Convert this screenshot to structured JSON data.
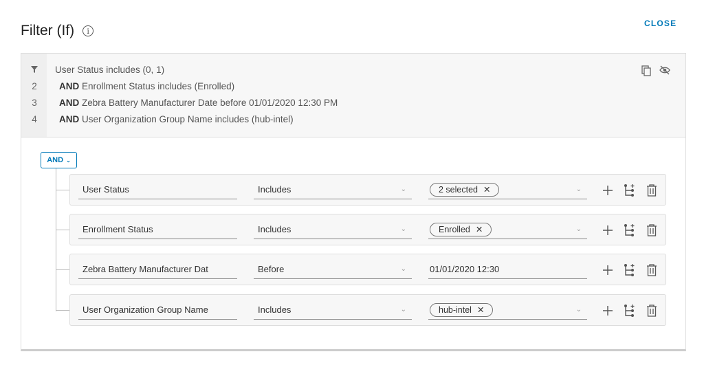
{
  "header": {
    "title": "Filter (If)",
    "close_label": "CLOSE"
  },
  "summary": {
    "lines": [
      {
        "num": "",
        "prefix": "",
        "text": "User Status includes (0, 1)"
      },
      {
        "num": "2",
        "prefix": "AND",
        "text": " Enrollment Status includes (Enrolled)"
      },
      {
        "num": "3",
        "prefix": "AND",
        "text": " Zebra Battery Manufacturer Date before 01/01/2020 12:30 PM"
      },
      {
        "num": "4",
        "prefix": "AND",
        "text": " User Organization Group Name includes (hub-intel)"
      }
    ]
  },
  "builder": {
    "operator_label": "AND",
    "rows": [
      {
        "attribute": "User Status",
        "operator": "Includes",
        "value": "2 selected",
        "value_type": "pill"
      },
      {
        "attribute": "Enrollment Status",
        "operator": "Includes",
        "value": "Enrolled",
        "value_type": "pill"
      },
      {
        "attribute": "Zebra Battery Manufacturer Dat",
        "operator": "Before",
        "value": "01/01/2020 12:30",
        "value_type": "text"
      },
      {
        "attribute": "User Organization Group Name",
        "operator": "Includes",
        "value": "hub-intel",
        "value_type": "pill"
      }
    ]
  },
  "colors": {
    "accent": "#0079b8"
  }
}
